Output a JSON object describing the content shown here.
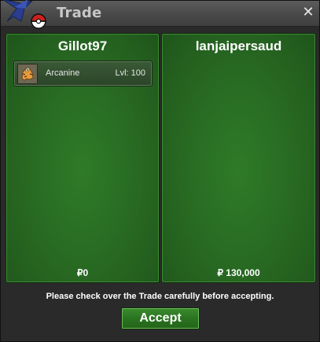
{
  "window": {
    "title": "Trade",
    "close_label": "✕"
  },
  "left_panel": {
    "player_name": "Gillot97",
    "money": "₽0",
    "items": [
      {
        "name": "Arcanine",
        "level": "Lvl: 100"
      }
    ]
  },
  "right_panel": {
    "player_name": "lanjaipersaud",
    "money": "₽ 130,000",
    "items": []
  },
  "footer": {
    "notice": "Please check over the Trade carefully before accepting.",
    "accept_label": "Accept"
  },
  "colors": {
    "panel_green": "#2a6f24",
    "button_green": "#2a7320",
    "titlebar": "#4a4a4a"
  }
}
